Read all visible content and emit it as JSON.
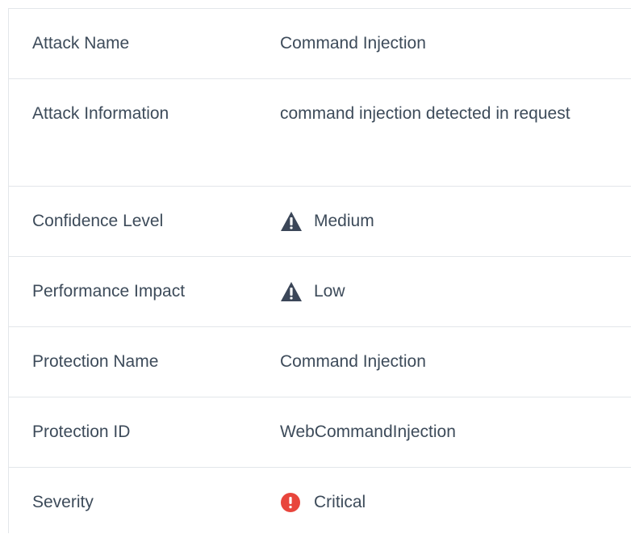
{
  "rows": [
    {
      "label": "Attack Name",
      "value": "Command Injection"
    },
    {
      "label": "Attack Information",
      "value": "command injection detected in request"
    },
    {
      "label": "Confidence Level",
      "value": "Medium",
      "icon": "warning-triangle-icon"
    },
    {
      "label": "Performance Impact",
      "value": "Low",
      "icon": "warning-triangle-icon"
    },
    {
      "label": "Protection Name",
      "value": "Command Injection"
    },
    {
      "label": "Protection ID",
      "value": "WebCommandInjection"
    },
    {
      "label": "Severity",
      "value": "Critical",
      "icon": "critical-alert-icon"
    }
  ],
  "colors": {
    "text": "#3d4b5a",
    "border": "#e3e6ea",
    "warning_icon": "#3b4658",
    "critical_icon": "#e8453c"
  }
}
